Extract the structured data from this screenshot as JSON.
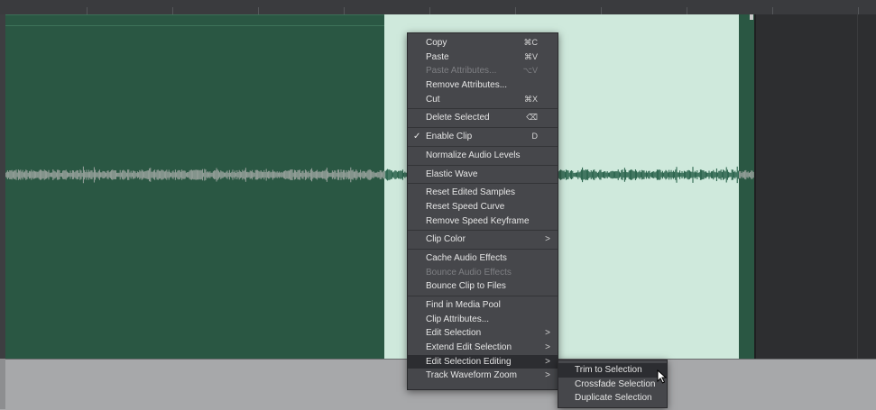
{
  "context_menu": {
    "items": [
      {
        "label": "Copy",
        "shortcut": "⌘C"
      },
      {
        "label": "Paste",
        "shortcut": "⌘V"
      },
      {
        "label": "Paste Attributes...",
        "shortcut": "⌥V"
      },
      {
        "label": "Remove Attributes..."
      },
      {
        "label": "Cut",
        "shortcut": "⌘X"
      },
      {
        "label": "Delete Selected",
        "shortcut": "⌫"
      },
      {
        "label": "Enable Clip",
        "shortcut": "D",
        "check": "✓"
      },
      {
        "label": "Normalize Audio Levels"
      },
      {
        "label": "Elastic Wave"
      },
      {
        "label": "Reset Edited Samples"
      },
      {
        "label": "Reset Speed Curve"
      },
      {
        "label": "Remove Speed Keyframe"
      },
      {
        "label": "Clip Color",
        "arrow": ">"
      },
      {
        "label": "Cache Audio Effects"
      },
      {
        "label": "Bounce Audio Effects"
      },
      {
        "label": "Bounce Clip to Files"
      },
      {
        "label": "Find in Media Pool"
      },
      {
        "label": "Clip Attributes..."
      },
      {
        "label": "Edit Selection",
        "arrow": ">"
      },
      {
        "label": "Extend Edit Selection",
        "arrow": ">"
      },
      {
        "label": "Edit Selection Editing",
        "arrow": ">"
      },
      {
        "label": "Track Waveform Zoom",
        "arrow": ">"
      }
    ]
  },
  "submenu": {
    "items": [
      {
        "label": "Trim to Selection"
      },
      {
        "label": "Crossfade Selection"
      },
      {
        "label": "Duplicate Selection"
      }
    ]
  },
  "colors": {
    "clip": "#2a5743",
    "selection": "#cfe9dc",
    "waveform_unselected": "#9aa39e",
    "waveform_selected": "#1f5a42",
    "menu_bg": "#46474b"
  },
  "icons": {
    "cursor": "arrow-pointer-icon",
    "check": "check-icon",
    "submenu": "chevron-right-icon"
  }
}
